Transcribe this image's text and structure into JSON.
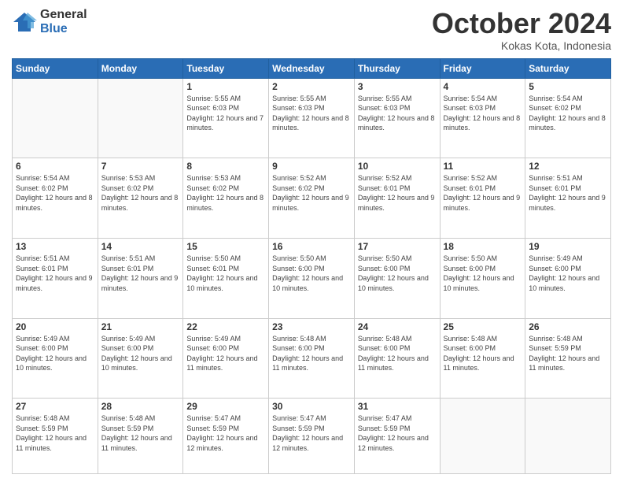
{
  "logo": {
    "general": "General",
    "blue": "Blue"
  },
  "header": {
    "month": "October 2024",
    "location": "Kokas Kota, Indonesia"
  },
  "weekdays": [
    "Sunday",
    "Monday",
    "Tuesday",
    "Wednesday",
    "Thursday",
    "Friday",
    "Saturday"
  ],
  "weeks": [
    [
      {
        "day": "",
        "info": ""
      },
      {
        "day": "",
        "info": ""
      },
      {
        "day": "1",
        "info": "Sunrise: 5:55 AM\nSunset: 6:03 PM\nDaylight: 12 hours and 7 minutes."
      },
      {
        "day": "2",
        "info": "Sunrise: 5:55 AM\nSunset: 6:03 PM\nDaylight: 12 hours and 8 minutes."
      },
      {
        "day": "3",
        "info": "Sunrise: 5:55 AM\nSunset: 6:03 PM\nDaylight: 12 hours and 8 minutes."
      },
      {
        "day": "4",
        "info": "Sunrise: 5:54 AM\nSunset: 6:03 PM\nDaylight: 12 hours and 8 minutes."
      },
      {
        "day": "5",
        "info": "Sunrise: 5:54 AM\nSunset: 6:02 PM\nDaylight: 12 hours and 8 minutes."
      }
    ],
    [
      {
        "day": "6",
        "info": "Sunrise: 5:54 AM\nSunset: 6:02 PM\nDaylight: 12 hours and 8 minutes."
      },
      {
        "day": "7",
        "info": "Sunrise: 5:53 AM\nSunset: 6:02 PM\nDaylight: 12 hours and 8 minutes."
      },
      {
        "day": "8",
        "info": "Sunrise: 5:53 AM\nSunset: 6:02 PM\nDaylight: 12 hours and 8 minutes."
      },
      {
        "day": "9",
        "info": "Sunrise: 5:52 AM\nSunset: 6:02 PM\nDaylight: 12 hours and 9 minutes."
      },
      {
        "day": "10",
        "info": "Sunrise: 5:52 AM\nSunset: 6:01 PM\nDaylight: 12 hours and 9 minutes."
      },
      {
        "day": "11",
        "info": "Sunrise: 5:52 AM\nSunset: 6:01 PM\nDaylight: 12 hours and 9 minutes."
      },
      {
        "day": "12",
        "info": "Sunrise: 5:51 AM\nSunset: 6:01 PM\nDaylight: 12 hours and 9 minutes."
      }
    ],
    [
      {
        "day": "13",
        "info": "Sunrise: 5:51 AM\nSunset: 6:01 PM\nDaylight: 12 hours and 9 minutes."
      },
      {
        "day": "14",
        "info": "Sunrise: 5:51 AM\nSunset: 6:01 PM\nDaylight: 12 hours and 9 minutes."
      },
      {
        "day": "15",
        "info": "Sunrise: 5:50 AM\nSunset: 6:01 PM\nDaylight: 12 hours and 10 minutes."
      },
      {
        "day": "16",
        "info": "Sunrise: 5:50 AM\nSunset: 6:00 PM\nDaylight: 12 hours and 10 minutes."
      },
      {
        "day": "17",
        "info": "Sunrise: 5:50 AM\nSunset: 6:00 PM\nDaylight: 12 hours and 10 minutes."
      },
      {
        "day": "18",
        "info": "Sunrise: 5:50 AM\nSunset: 6:00 PM\nDaylight: 12 hours and 10 minutes."
      },
      {
        "day": "19",
        "info": "Sunrise: 5:49 AM\nSunset: 6:00 PM\nDaylight: 12 hours and 10 minutes."
      }
    ],
    [
      {
        "day": "20",
        "info": "Sunrise: 5:49 AM\nSunset: 6:00 PM\nDaylight: 12 hours and 10 minutes."
      },
      {
        "day": "21",
        "info": "Sunrise: 5:49 AM\nSunset: 6:00 PM\nDaylight: 12 hours and 10 minutes."
      },
      {
        "day": "22",
        "info": "Sunrise: 5:49 AM\nSunset: 6:00 PM\nDaylight: 12 hours and 11 minutes."
      },
      {
        "day": "23",
        "info": "Sunrise: 5:48 AM\nSunset: 6:00 PM\nDaylight: 12 hours and 11 minutes."
      },
      {
        "day": "24",
        "info": "Sunrise: 5:48 AM\nSunset: 6:00 PM\nDaylight: 12 hours and 11 minutes."
      },
      {
        "day": "25",
        "info": "Sunrise: 5:48 AM\nSunset: 6:00 PM\nDaylight: 12 hours and 11 minutes."
      },
      {
        "day": "26",
        "info": "Sunrise: 5:48 AM\nSunset: 5:59 PM\nDaylight: 12 hours and 11 minutes."
      }
    ],
    [
      {
        "day": "27",
        "info": "Sunrise: 5:48 AM\nSunset: 5:59 PM\nDaylight: 12 hours and 11 minutes."
      },
      {
        "day": "28",
        "info": "Sunrise: 5:48 AM\nSunset: 5:59 PM\nDaylight: 12 hours and 11 minutes."
      },
      {
        "day": "29",
        "info": "Sunrise: 5:47 AM\nSunset: 5:59 PM\nDaylight: 12 hours and 12 minutes."
      },
      {
        "day": "30",
        "info": "Sunrise: 5:47 AM\nSunset: 5:59 PM\nDaylight: 12 hours and 12 minutes."
      },
      {
        "day": "31",
        "info": "Sunrise: 5:47 AM\nSunset: 5:59 PM\nDaylight: 12 hours and 12 minutes."
      },
      {
        "day": "",
        "info": ""
      },
      {
        "day": "",
        "info": ""
      }
    ]
  ]
}
